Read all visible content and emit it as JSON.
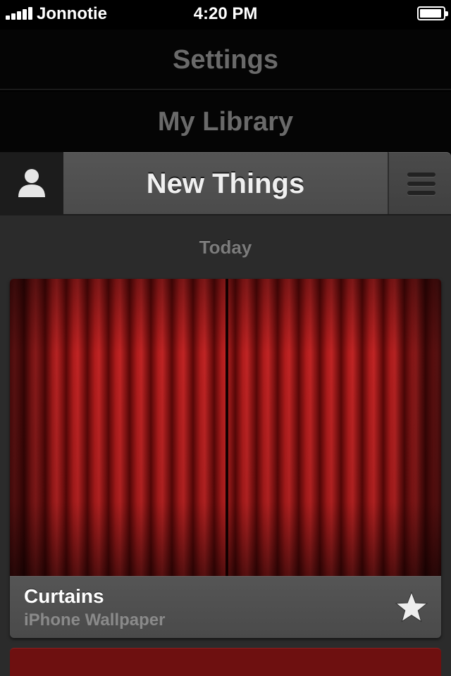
{
  "status_bar": {
    "carrier": "Jonnotie",
    "time": "4:20 PM",
    "signal_bars": 5,
    "battery_level": 0.8
  },
  "menu": {
    "items": [
      {
        "label": "Settings"
      },
      {
        "label": "My Library"
      }
    ]
  },
  "header": {
    "title": "New Things",
    "profile_icon": "person-icon",
    "menu_icon": "hamburger-menu-icon"
  },
  "feed": {
    "section_label": "Today",
    "items": [
      {
        "title": "Curtains",
        "subtitle": "iPhone Wallpaper",
        "image": "red-curtains-wallpaper",
        "favorite_icon": "star-icon"
      }
    ]
  },
  "colors": {
    "background": "#000000",
    "header": "#4f4f4f",
    "content_background": "#2b2b2b",
    "curtain_red": "#a51818"
  }
}
